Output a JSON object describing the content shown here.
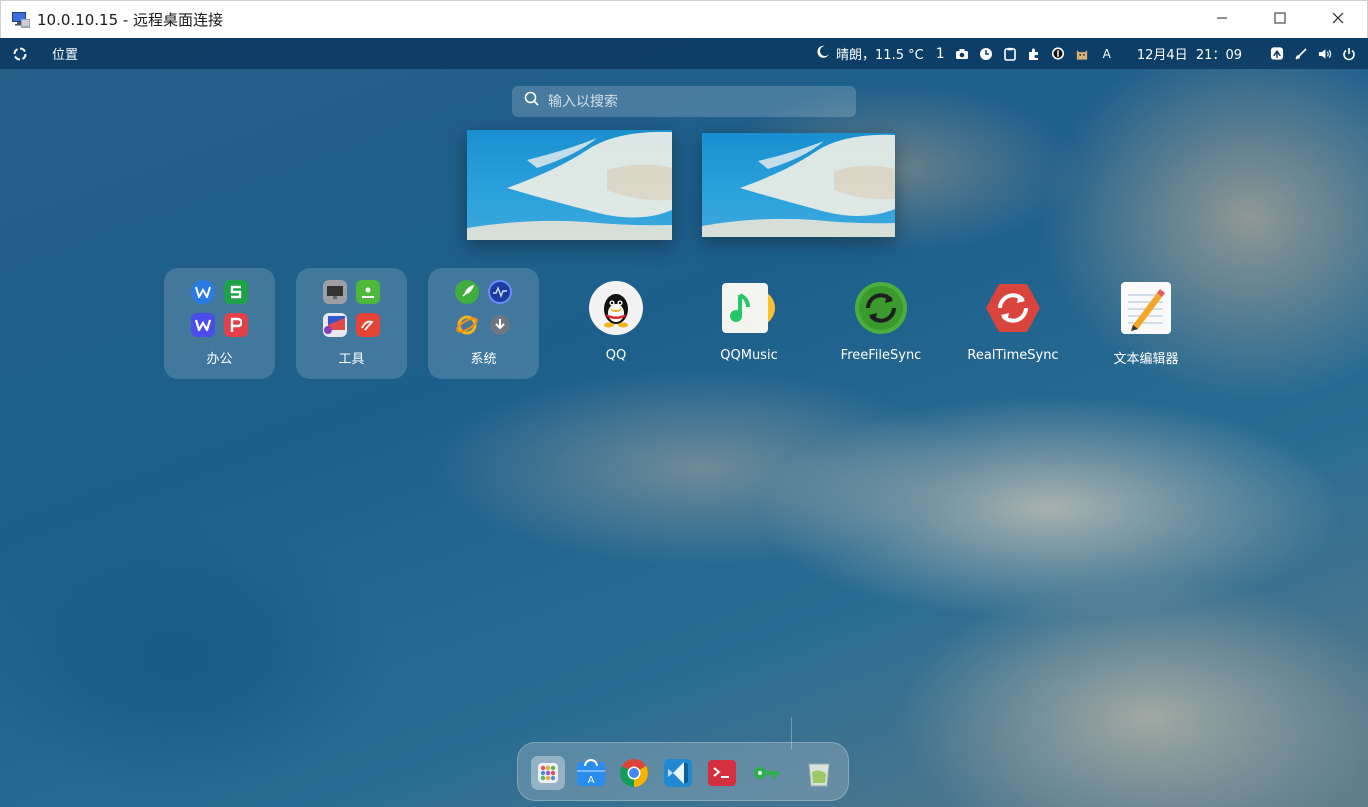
{
  "window": {
    "title": "10.0.10.15 - 远程桌面连接",
    "rdp_icon": "remote-desktop-icon",
    "controls": [
      "minimize-icon",
      "maximize-icon",
      "close-icon"
    ]
  },
  "panel": {
    "places_label": "位置",
    "weather_text": "晴朗，11.5 °C",
    "workspace_number": "1",
    "keyboard_layout": "A",
    "datetime": "12月4日  21：09"
  },
  "search": {
    "placeholder": "输入以搜索"
  },
  "folders": [
    {
      "label": "办公",
      "icons": [
        "wps-writer-icon",
        "wps-spreadsheet-icon",
        "word-icon",
        "wps-presentation-icon"
      ]
    },
    {
      "label": "工具",
      "icons": [
        "monitor-icon",
        "installer-icon",
        "screenshot-icon",
        "annotation-icon"
      ]
    },
    {
      "label": "系统",
      "icons": [
        "rocket-icon",
        "system-monitor-icon",
        "network-icon",
        "download-icon"
      ]
    }
  ],
  "apps": [
    {
      "label": "QQ",
      "icon": "qq-icon"
    },
    {
      "label": "QQMusic",
      "icon": "qqmusic-icon"
    },
    {
      "label": "FreeFileSync",
      "icon": "freefilesync-icon"
    },
    {
      "label": "RealTimeSync",
      "icon": "realtimesync-icon"
    },
    {
      "label": "文本编辑器",
      "icon": "text-editor-icon"
    }
  ],
  "dock": [
    "launcher-icon",
    "app-store-icon",
    "chrome-icon",
    "vscode-icon",
    "terminal-icon",
    "key-icon",
    "trash-icon"
  ],
  "colors": {
    "panel_bg": "#0a375f",
    "desktop_blue": "#1d5f8c",
    "sync_green": "#4caf3b",
    "sync_red": "#d9453d"
  }
}
